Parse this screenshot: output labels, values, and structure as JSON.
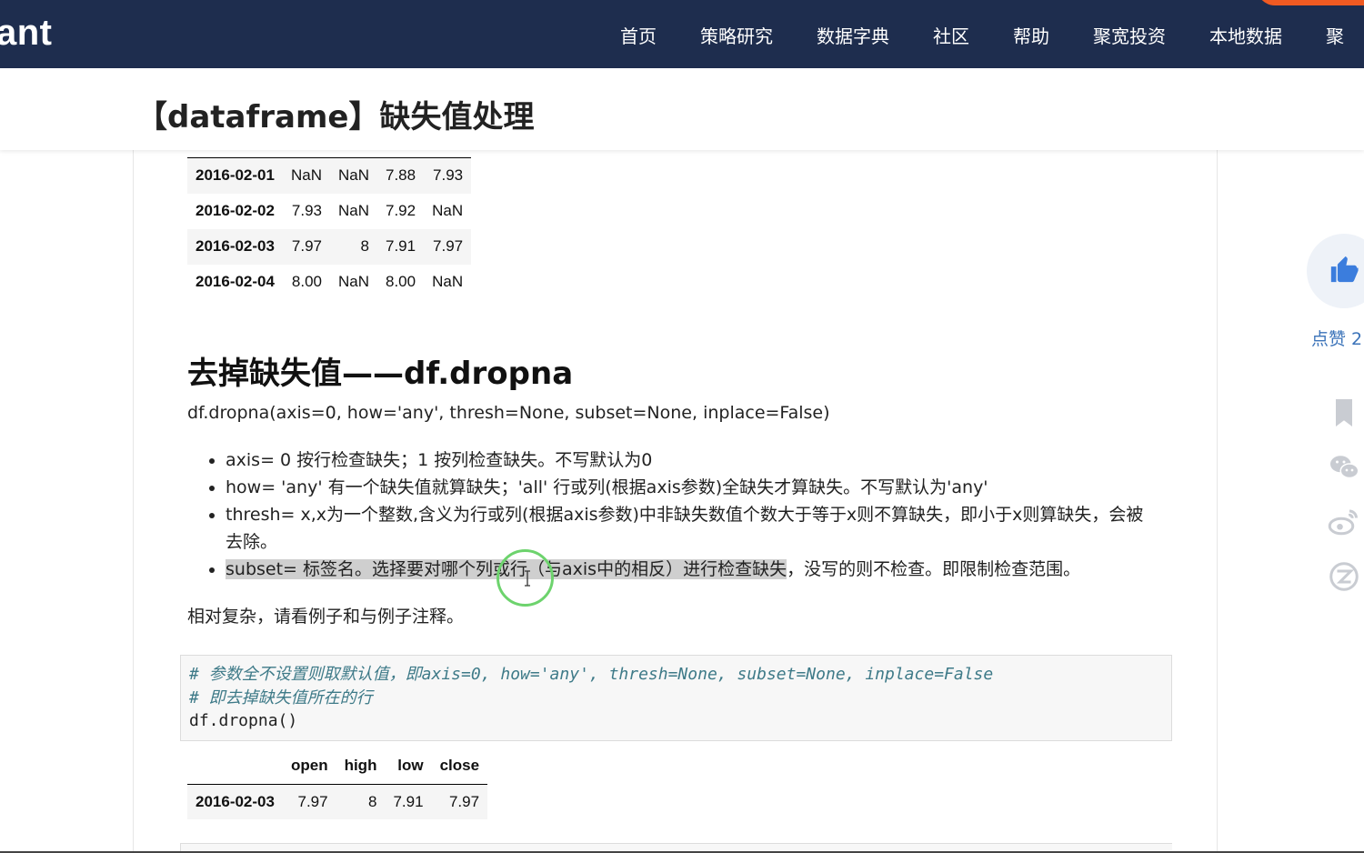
{
  "nav": {
    "brand": "ant",
    "items": [
      "首页",
      "策略研究",
      "数据字典",
      "社区",
      "帮助",
      "聚宽投资",
      "本地数据",
      "聚"
    ]
  },
  "article": {
    "title": "【dataframe】缺失值处理",
    "table_top": {
      "rows": [
        [
          "2016-02-01",
          "NaN",
          "NaN",
          "7.88",
          "7.93"
        ],
        [
          "2016-02-02",
          "7.93",
          "NaN",
          "7.92",
          "NaN"
        ],
        [
          "2016-02-03",
          "7.97",
          "8",
          "7.91",
          "7.97"
        ],
        [
          "2016-02-04",
          "8.00",
          "NaN",
          "8.00",
          "NaN"
        ]
      ]
    },
    "section_heading": "去掉缺失值——df.dropna",
    "signature": "df.dropna(axis=0, how='any', thresh=None, subset=None, inplace=False)",
    "params": [
      "axis= 0 按行检查缺失；1 按列检查缺失。不写默认为0",
      "how= 'any' 有一个缺失值就算缺失；'all' 行或列(根据axis参数)全缺失才算缺失。不写默认为'any'",
      "thresh= x,x为一个整数,含义为行或列(根据axis参数)中非缺失数值个数大于等于x则不算缺失，即小于x则算缺失，会被去除。"
    ],
    "subset_param": {
      "highlighted": "subset= 标签名。选择要对哪个列或行（与axis中的相反）进行检查缺失",
      "rest": "，没写的则不检查。即限制检查范围。"
    },
    "note": "相对复杂，请看例子和与例子注释。",
    "code": {
      "comment1": "# 参数全不设置则取默认值，即axis=0, how='any', thresh=None, subset=None, inplace=False",
      "comment2": "# 即去掉缺失值所在的行",
      "line": "df.dropna()"
    },
    "table_bottom": {
      "columns": [
        "",
        "open",
        "high",
        "low",
        "close"
      ],
      "rows": [
        [
          "2016-02-03",
          "7.97",
          "8",
          "7.91",
          "7.97"
        ]
      ]
    }
  },
  "sidebar": {
    "like_label": "点赞 2",
    "icons": [
      "thumbs-up-icon",
      "bookmark-icon",
      "wechat-icon",
      "weibo-icon",
      "qzone-icon"
    ]
  },
  "colors": {
    "nav_bg": "#1e2d4e",
    "accent_blue": "#3b73b9",
    "highlight_gray": "#cfcfcf",
    "code_comment": "#3e7a88",
    "cursor_ring": "#6dd36d"
  }
}
